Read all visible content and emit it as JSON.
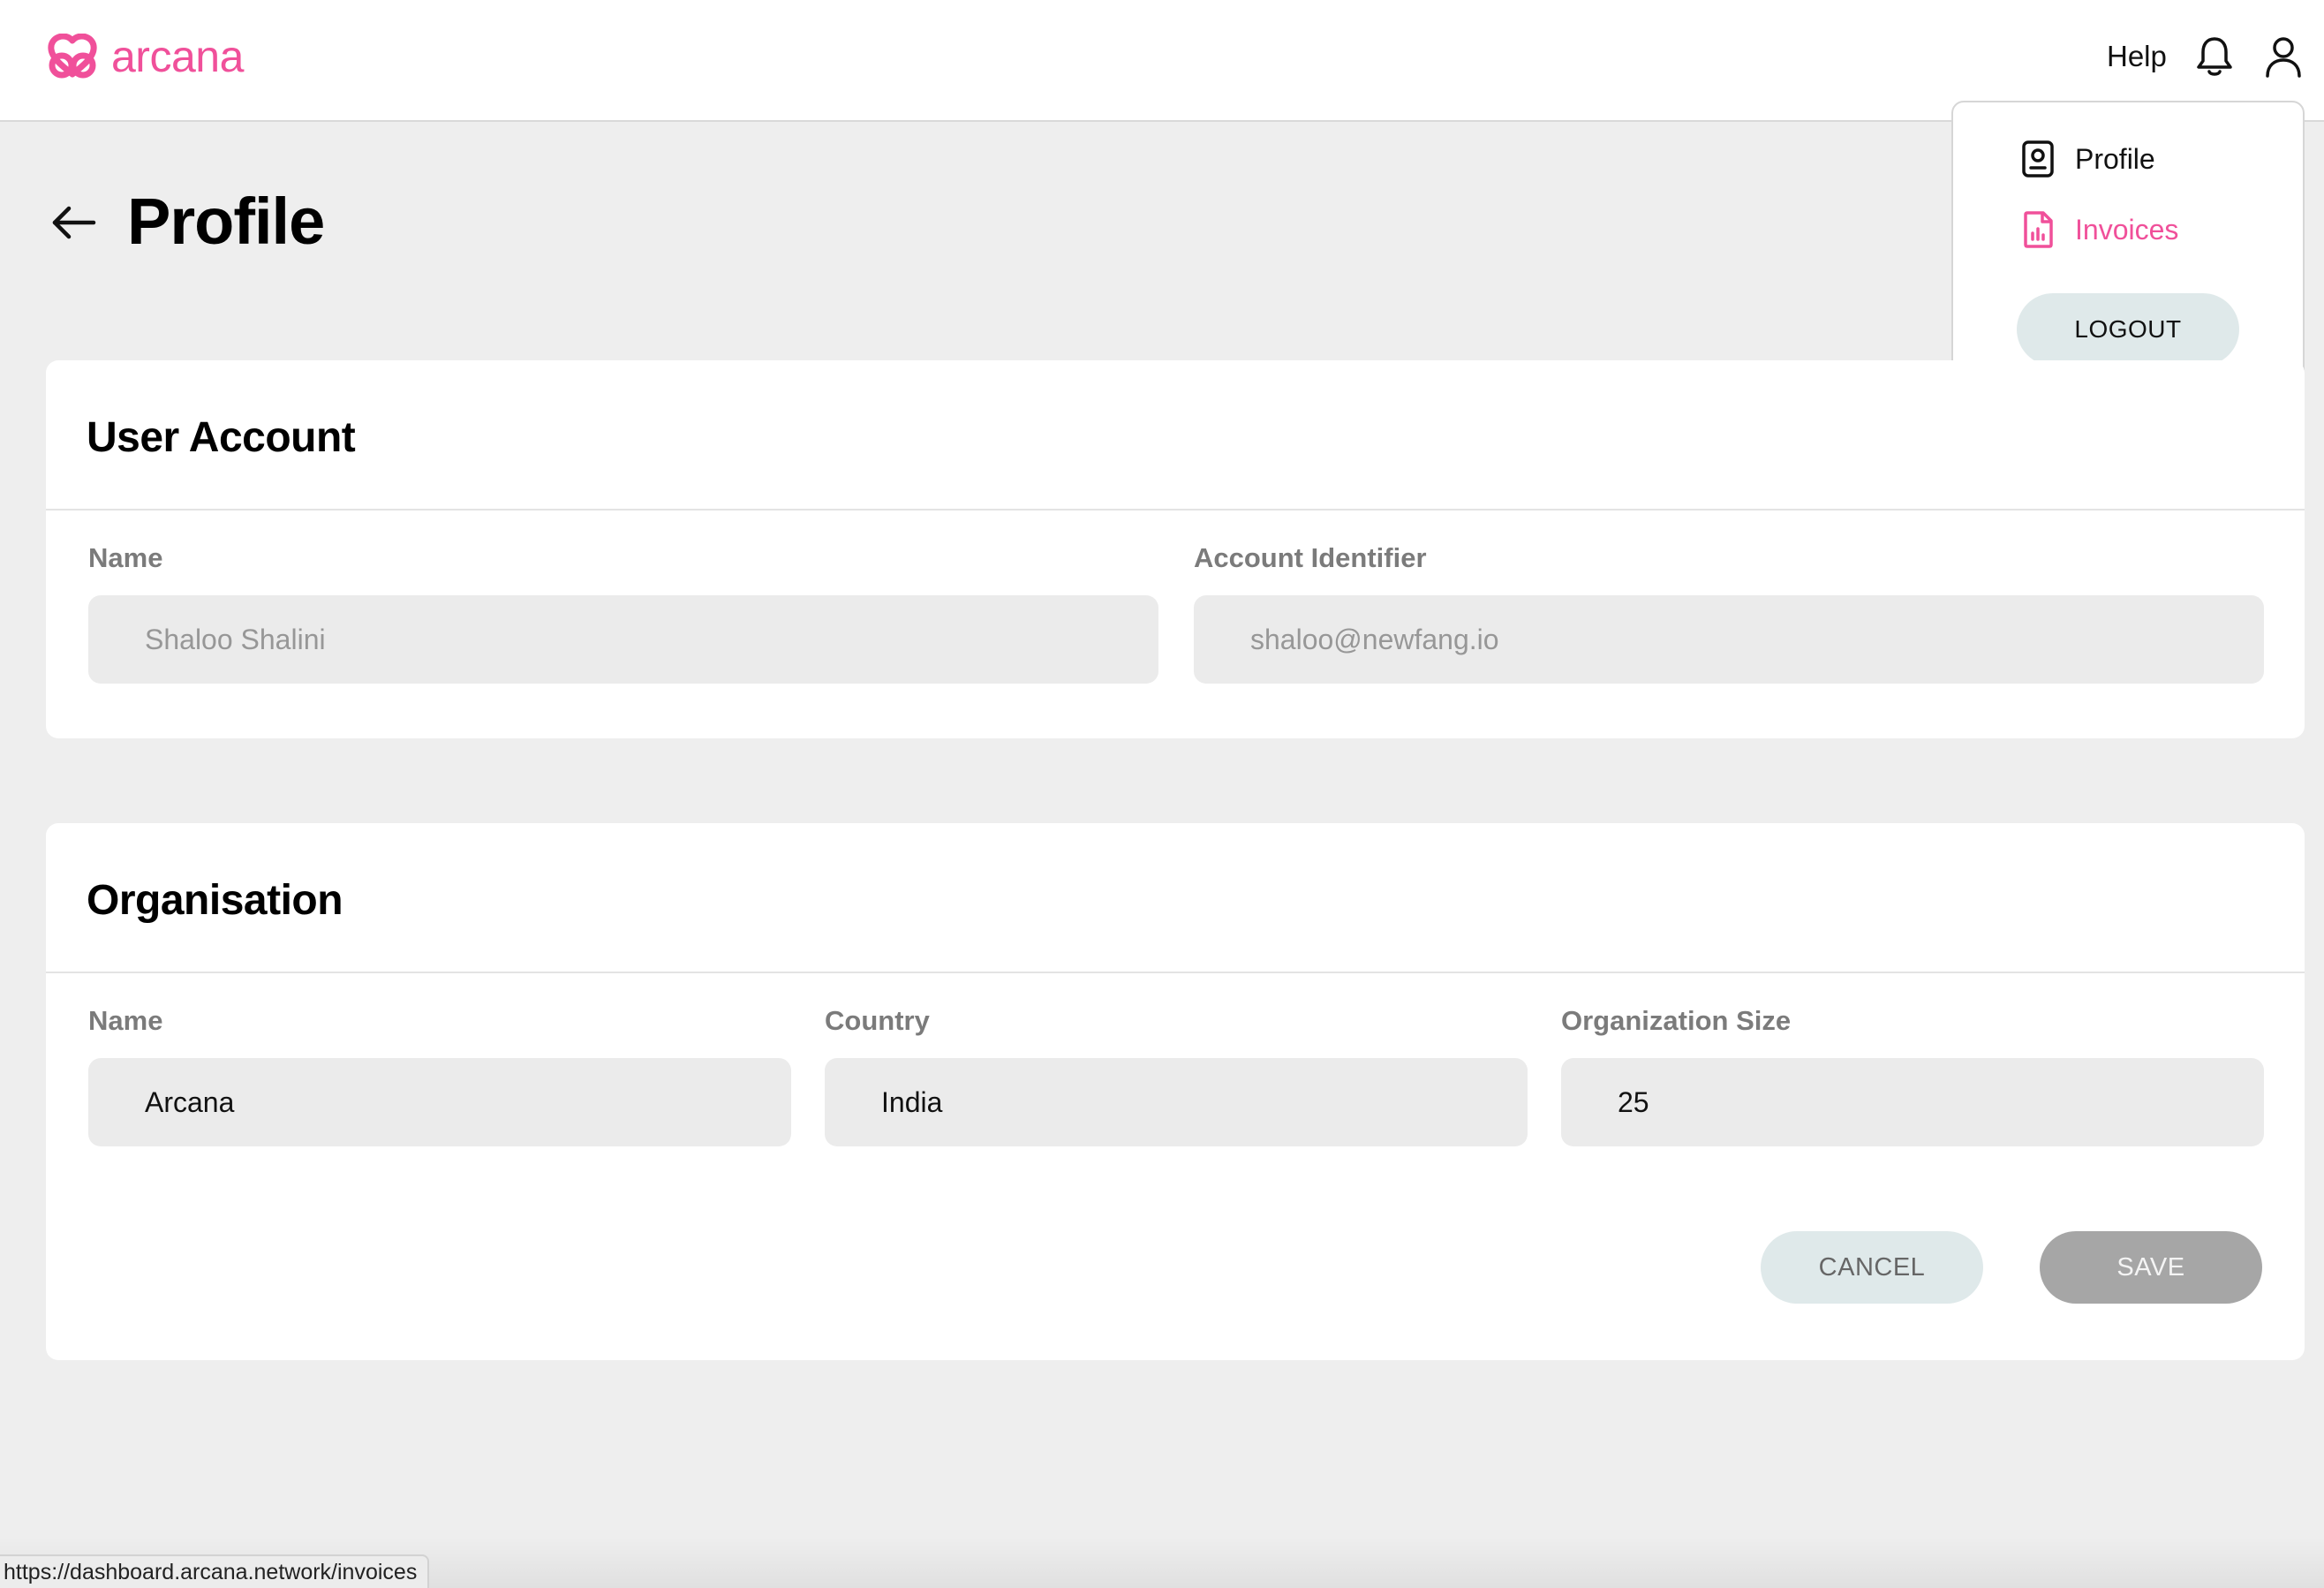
{
  "header": {
    "brand": "arcana",
    "help_label": "Help",
    "accent_color": "#f0509a"
  },
  "user_menu": {
    "items": [
      {
        "label": "Profile",
        "icon": "profile-badge-icon",
        "active": false
      },
      {
        "label": "Invoices",
        "icon": "invoice-chart-icon",
        "active": true
      }
    ],
    "logout_label": "LOGOUT"
  },
  "page": {
    "title": "Profile"
  },
  "user_account": {
    "title": "User Account",
    "name": {
      "label": "Name",
      "value": "Shaloo Shalini"
    },
    "identifier": {
      "label": "Account Identifier",
      "value": "shaloo@newfang.io"
    }
  },
  "organisation": {
    "title": "Organisation",
    "name": {
      "label": "Name",
      "value": "Arcana"
    },
    "country": {
      "label": "Country",
      "value": "India"
    },
    "size": {
      "label": "Organization Size",
      "value": "25"
    },
    "cancel_label": "CANCEL",
    "save_label": "SAVE"
  },
  "status_url": "https://dashboard.arcana.network/invoices"
}
